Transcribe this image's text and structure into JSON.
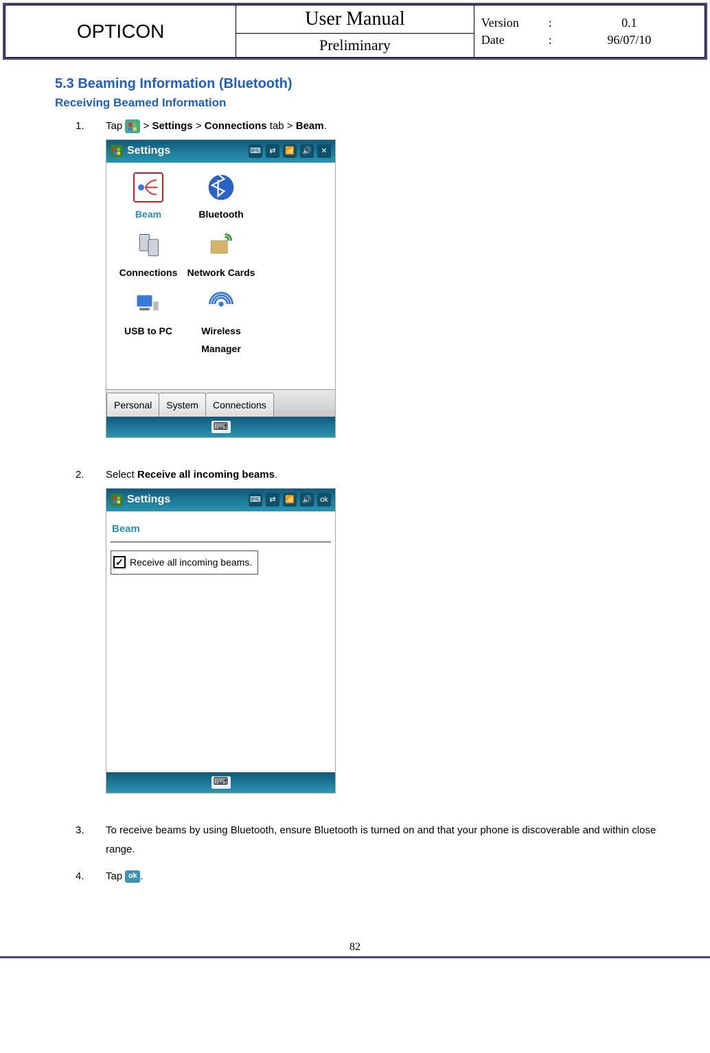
{
  "header": {
    "brand": "OPTICON",
    "title": "User Manual",
    "subtitle": "Preliminary",
    "meta": {
      "version_label": "Version",
      "version": "0.1",
      "date_label": "Date",
      "date": "96/07/10"
    }
  },
  "section": {
    "num_title": "5.3 Beaming Information (Bluetooth)",
    "subhead": "Receiving Beamed Information"
  },
  "steps": {
    "s1": {
      "n": "1.",
      "a": "Tap ",
      "b": " > ",
      "c": "Settings",
      "d": " > ",
      "e": "Connections",
      "f": " tab > ",
      "g": "Beam",
      "h": "."
    },
    "s2": {
      "n": "2.",
      "a": "Select ",
      "b": "Receive all incoming beams",
      "c": "."
    },
    "s3": {
      "n": "3.",
      "t": "To receive beams by using Bluetooth, ensure Bluetooth is turned on and that your phone is discoverable and within close range."
    },
    "s4": {
      "n": "4.",
      "a": "Tap ",
      "b": "."
    }
  },
  "phone1": {
    "title": "Settings",
    "items": {
      "beam": "Beam",
      "bt": "Bluetooth",
      "conn": "Connections",
      "net": "Network Cards",
      "usb": "USB to PC",
      "wm": "Wireless Manager"
    },
    "tabs": {
      "p": "Personal",
      "s": "System",
      "c": "Connections"
    }
  },
  "phone2": {
    "title": "Settings",
    "subtitle": "Beam",
    "check_label": "Receive all incoming beams.",
    "ok": "ok"
  },
  "ok_text": "ok",
  "page": "82"
}
